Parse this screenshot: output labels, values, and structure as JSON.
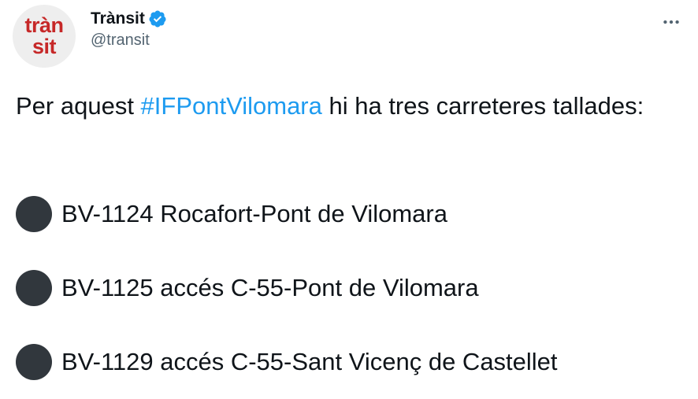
{
  "author": {
    "avatar_line1": "tràn",
    "avatar_line2": "sit",
    "display_name": "Trànsit",
    "handle": "@transit",
    "verified_icon": "verified-badge-icon"
  },
  "menu": {
    "icon": "more-horizontal-icon"
  },
  "tweet": {
    "text_before": "Per aquest ",
    "hashtag": "#IFPontVilomara",
    "text_after": " hi ha tres carreteres tallades:",
    "roads": [
      "BV-1124 Rocafort-Pont de Vilomara",
      "BV-1125 accés C-55-Pont de Vilomara",
      "BV-1129 accés C-55-Sant Vicenç de Castellet"
    ]
  },
  "colors": {
    "hashtag": "#1d9bf0",
    "logo": "#c62828",
    "bullet": "#31373d",
    "handle": "#536471"
  }
}
